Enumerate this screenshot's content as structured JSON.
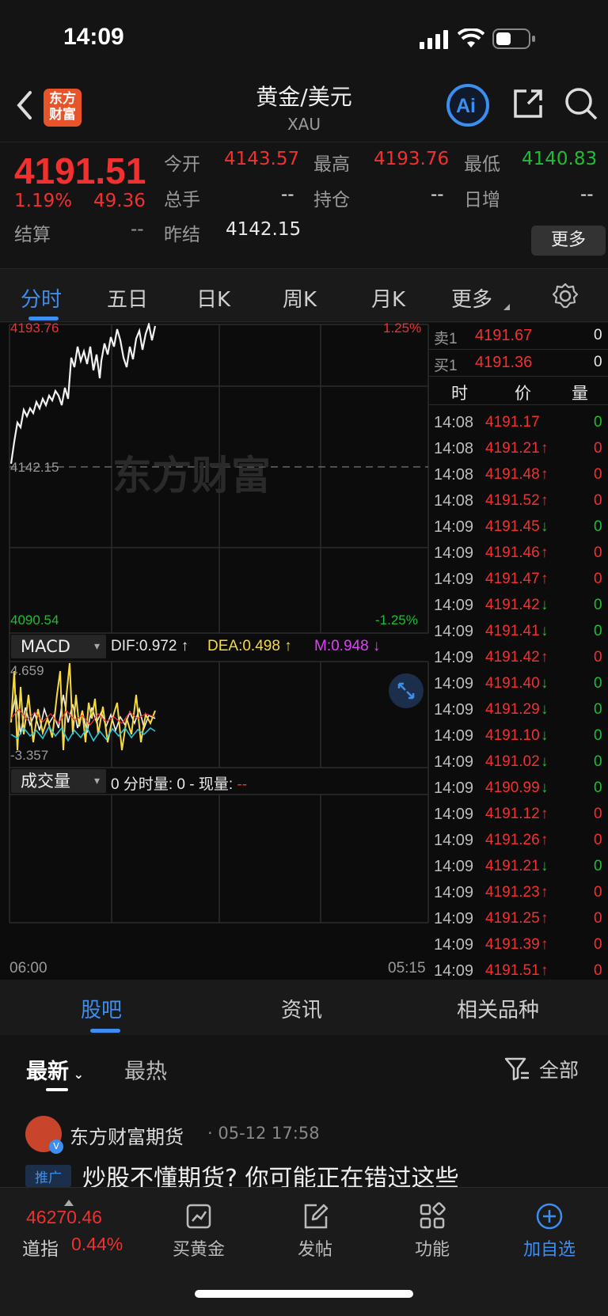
{
  "status_bar": {
    "time": "14:09"
  },
  "header": {
    "title": "黄金/美元",
    "subtitle": "XAU",
    "logo_text": "东方\n财富"
  },
  "quote": {
    "price": "4191.51",
    "change_pct": "1.19%",
    "change": "49.36",
    "fields": {
      "open_label": "今开",
      "open": "4143.57",
      "high_label": "最高",
      "high": "4193.76",
      "low_label": "最低",
      "low": "4140.83",
      "volume_label": "总手",
      "volume": "--",
      "oi_label": "持仓",
      "oi": "--",
      "daily_inc_label": "日增",
      "daily_inc": "--",
      "settle_label": "结算",
      "settle": "--",
      "prev_settle_label": "昨结",
      "prev_settle": "4142.15"
    },
    "more_label": "更多"
  },
  "tabs": [
    "分时",
    "五日",
    "日K",
    "周K",
    "月K",
    "更多"
  ],
  "chart": {
    "top_price": "4193.76",
    "top_pct": "1.25%",
    "mid_price": "4142.15",
    "bottom_price": "4090.54",
    "bottom_pct": "-1.25%",
    "watermark": "东方财富",
    "time_start": "06:00",
    "time_end": "05:15",
    "macd": {
      "label": "MACD",
      "dif": "DIF:0.972 ↑",
      "dea": "DEA:0.498 ↑",
      "m": "M:0.948 ↓",
      "top": "4.659",
      "bottom": "-3.357"
    },
    "volume": {
      "label": "成交量",
      "info": "0 分时量: 0 - 现量:",
      "dash": "--"
    }
  },
  "book": {
    "ask_label": "卖1",
    "ask_price": "4191.67",
    "ask_qty": "0",
    "bid_label": "买1",
    "bid_price": "4191.36",
    "bid_qty": "0",
    "col_time": "时",
    "col_price": "价",
    "col_qty": "量",
    "trades": [
      {
        "time": "14:08",
        "price": "4191.17",
        "dir": "",
        "qty": "0",
        "c": "green"
      },
      {
        "time": "14:08",
        "price": "4191.21",
        "dir": "↑",
        "qty": "0",
        "c": "red"
      },
      {
        "time": "14:08",
        "price": "4191.48",
        "dir": "↑",
        "qty": "0",
        "c": "red"
      },
      {
        "time": "14:08",
        "price": "4191.52",
        "dir": "↑",
        "qty": "0",
        "c": "red"
      },
      {
        "time": "14:09",
        "price": "4191.45",
        "dir": "↓",
        "qty": "0",
        "c": "green"
      },
      {
        "time": "14:09",
        "price": "4191.46",
        "dir": "↑",
        "qty": "0",
        "c": "red"
      },
      {
        "time": "14:09",
        "price": "4191.47",
        "dir": "↑",
        "qty": "0",
        "c": "red"
      },
      {
        "time": "14:09",
        "price": "4191.42",
        "dir": "↓",
        "qty": "0",
        "c": "green"
      },
      {
        "time": "14:09",
        "price": "4191.41",
        "dir": "↓",
        "qty": "0",
        "c": "green"
      },
      {
        "time": "14:09",
        "price": "4191.42",
        "dir": "↑",
        "qty": "0",
        "c": "red"
      },
      {
        "time": "14:09",
        "price": "4191.40",
        "dir": "↓",
        "qty": "0",
        "c": "green"
      },
      {
        "time": "14:09",
        "price": "4191.29",
        "dir": "↓",
        "qty": "0",
        "c": "green"
      },
      {
        "time": "14:09",
        "price": "4191.10",
        "dir": "↓",
        "qty": "0",
        "c": "green"
      },
      {
        "time": "14:09",
        "price": "4191.02",
        "dir": "↓",
        "qty": "0",
        "c": "green"
      },
      {
        "time": "14:09",
        "price": "4190.99",
        "dir": "↓",
        "qty": "0",
        "c": "green"
      },
      {
        "time": "14:09",
        "price": "4191.12",
        "dir": "↑",
        "qty": "0",
        "c": "red"
      },
      {
        "time": "14:09",
        "price": "4191.26",
        "dir": "↑",
        "qty": "0",
        "c": "red"
      },
      {
        "time": "14:09",
        "price": "4191.21",
        "dir": "↓",
        "qty": "0",
        "c": "green"
      },
      {
        "time": "14:09",
        "price": "4191.23",
        "dir": "↑",
        "qty": "0",
        "c": "red"
      },
      {
        "time": "14:09",
        "price": "4191.25",
        "dir": "↑",
        "qty": "0",
        "c": "red"
      },
      {
        "time": "14:09",
        "price": "4191.39",
        "dir": "↑",
        "qty": "0",
        "c": "red"
      },
      {
        "time": "14:09",
        "price": "4191.51",
        "dir": "↑",
        "qty": "0",
        "c": "red"
      }
    ]
  },
  "subtabs": [
    "股吧",
    "资讯",
    "相关品种"
  ],
  "feed": {
    "sort_latest": "最新",
    "sort_hot": "最热",
    "filter_label": "全部",
    "post_author": "东方财富期货",
    "post_time": "· 05-12 17:58",
    "post_tag": "推广",
    "post_title": "炒股不懂期货? 你可能正在错过这些"
  },
  "bottom_nav": {
    "index_value": "46270.46",
    "index_name": "道指",
    "index_pct": "0.44%",
    "items": [
      "买黄金",
      "发帖",
      "功能",
      "加自选"
    ]
  },
  "colors": {
    "up": "#f2302f",
    "down": "#1fbd35",
    "accent": "#3c8ff0",
    "bg": "#141414"
  }
}
